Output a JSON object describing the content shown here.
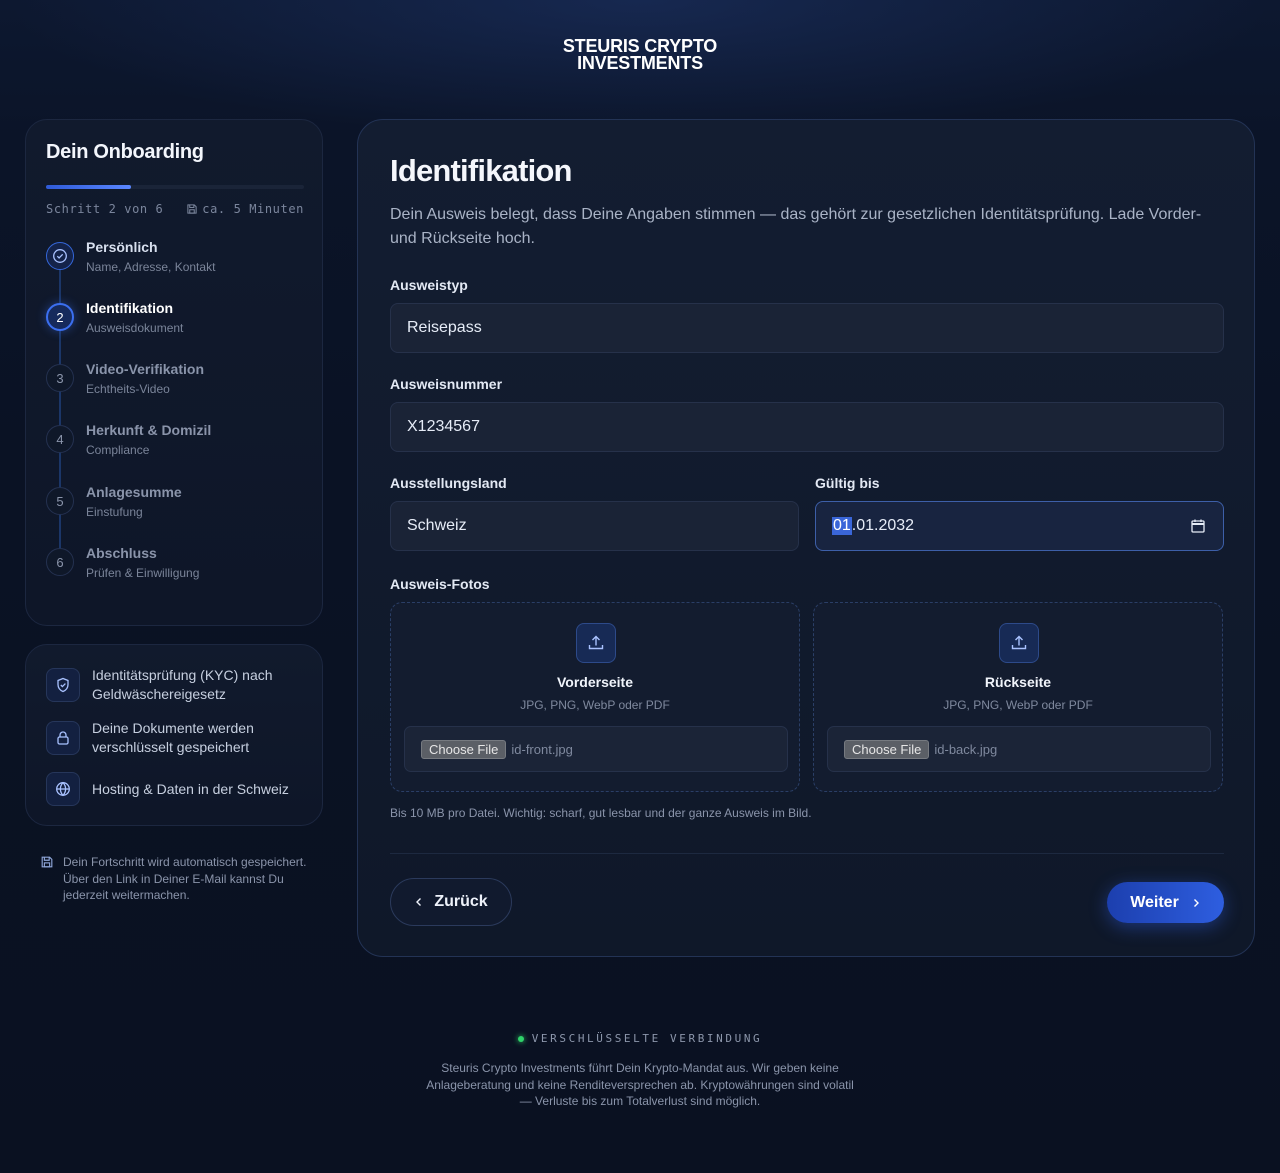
{
  "brand": {
    "line1": "STEURIS CRYPTO",
    "line2": "INVESTMENTS"
  },
  "sidebar": {
    "title": "Dein Onboarding",
    "progress": 0.33,
    "step_counter": "Schritt 2 von 6",
    "time_estimate": "ca. 5 Minuten",
    "steps": [
      {
        "number": "",
        "name": "Persönlich",
        "sub": "Name, Adresse, Kontakt",
        "state": "done"
      },
      {
        "number": "2",
        "name": "Identifikation",
        "sub": "Ausweisdokument",
        "state": "active"
      },
      {
        "number": "3",
        "name": "Video-Verifikation",
        "sub": "Echtheits-Video",
        "state": "upcoming"
      },
      {
        "number": "4",
        "name": "Herkunft & Domizil",
        "sub": "Compliance",
        "state": "upcoming"
      },
      {
        "number": "5",
        "name": "Anlagesumme",
        "sub": "Einstufung",
        "state": "upcoming"
      },
      {
        "number": "6",
        "name": "Abschluss",
        "sub": "Prüfen & Einwilligung",
        "state": "upcoming"
      }
    ]
  },
  "trust": {
    "items": [
      {
        "icon": "shield-check-icon",
        "text": "Identitätsprüfung (KYC) nach Geldwäschereigesetz"
      },
      {
        "icon": "lock-icon",
        "text": "Deine Dokumente werden verschlüsselt gespeichert"
      },
      {
        "icon": "globe-icon",
        "text": "Hosting & Daten in der Schweiz"
      }
    ]
  },
  "autosave": {
    "icon": "save-icon",
    "text": "Dein Fortschritt wird automatisch gespeichert. Über den Link in Deiner E-Mail kannst Du jederzeit weitermachen."
  },
  "form": {
    "title": "Identifikation",
    "description": "Dein Ausweis belegt, dass Deine Angaben stimmen — das gehört zur gesetzlichen Identitätsprüfung. Lade Vorder- und Rückseite hoch.",
    "id_type": {
      "label": "Ausweistyp",
      "value": "Reisepass"
    },
    "id_number": {
      "label": "Ausweisnummer",
      "value": "X1234567"
    },
    "country": {
      "label": "Ausstellungsland",
      "value": "Schweiz"
    },
    "valid_until": {
      "label": "Gültig bis",
      "value_highlight": "01",
      "value_rest": ".01.2032"
    },
    "photos_label": "Ausweis-Fotos",
    "front": {
      "title": "Vorderseite",
      "formats": "JPG, PNG, WebP oder PDF",
      "button": "Choose File",
      "file": "id-front.jpg"
    },
    "back": {
      "title": "Rückseite",
      "formats": "JPG, PNG, WebP oder PDF",
      "button": "Choose File",
      "file": "id-back.jpg"
    },
    "note": "Bis 10 MB pro Datei. Wichtig: scharf, gut lesbar und der ganze Ausweis im Bild.",
    "back_button": "Zurück",
    "next_button": "Weiter"
  },
  "footer": {
    "secure": "VERSCHLÜSSELTE VERBINDUNG",
    "disclaimer": "Steuris Crypto Investments führt Dein Krypto-Mandat aus. Wir geben keine Anlageberatung und keine Renditeversprechen ab. Kryptowährungen sind volatil — Verluste bis zum Totalverlust sind möglich."
  },
  "colors": {
    "accent": "#2e5ee0",
    "background": "#0a1224",
    "secure_dot": "#2fd36a"
  }
}
